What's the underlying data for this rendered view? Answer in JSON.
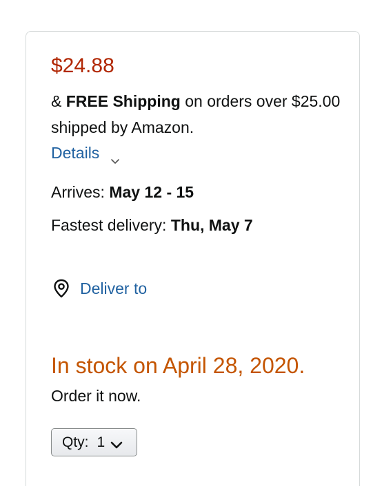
{
  "price": "$24.88",
  "shipping": {
    "prefix": "& ",
    "free_label": "FREE Shipping",
    "suffix": " on orders over $25.00 shipped by Amazon."
  },
  "details_link": "Details",
  "arrives": {
    "label": "Arrives: ",
    "value": "May 12 - 15"
  },
  "fastest": {
    "label": "Fastest delivery: ",
    "value": "Thu, May 7"
  },
  "deliver_to": "Deliver to",
  "stock": {
    "status": "In stock on April 28, 2020.",
    "note": "Order it now."
  },
  "quantity": {
    "label": "Qty:",
    "value": "1"
  },
  "colors": {
    "price": "#b12704",
    "link": "#2162a1",
    "stock": "#c45500"
  },
  "icons": {
    "details": "chevron-down-icon",
    "deliver": "location-pin-icon",
    "qty": "chevron-down-icon"
  }
}
